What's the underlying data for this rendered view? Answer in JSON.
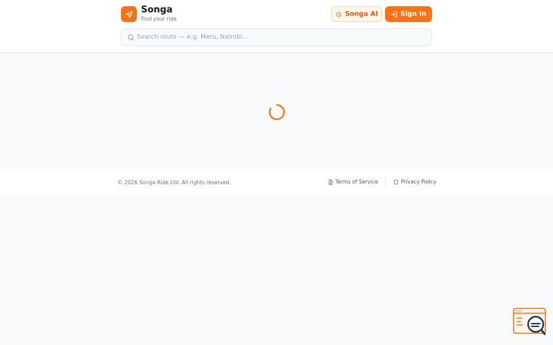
{
  "header": {
    "brand_name": "Songa",
    "brand_tagline": "Find your ride",
    "logo_icon": "navigation-arrow-icon",
    "ai_button_label": "Songa AI",
    "signin_button_label": "Sign In"
  },
  "search": {
    "placeholder": "Search route — e.g. Meru, Nairobi...",
    "value": ""
  },
  "footer": {
    "copyright": "© 2026 Songa Ride Ltd. All rights reserved.",
    "terms_label": "Terms of Service",
    "privacy_label": "Privacy Policy"
  },
  "colors": {
    "accent": "#f97316",
    "accent_light": "#fff7ed",
    "background": "#f8fafc"
  }
}
